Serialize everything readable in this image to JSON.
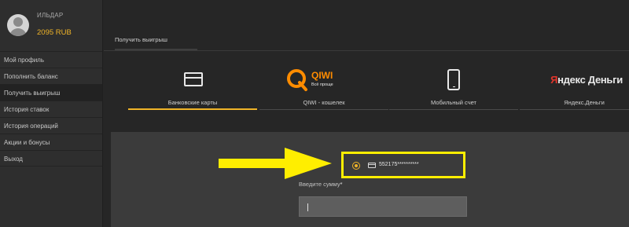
{
  "user": {
    "name": "ИЛЬДАР",
    "balance": "2095 RUB"
  },
  "sidebar": {
    "items": [
      {
        "label": "Мой профиль"
      },
      {
        "label": "Пополнить баланс"
      },
      {
        "label": "Получить выигрыш"
      },
      {
        "label": "История ставок"
      },
      {
        "label": "История операций"
      },
      {
        "label": "Акции и бонусы"
      },
      {
        "label": "Выход"
      }
    ],
    "active_index": 2
  },
  "header": {
    "tab_label": "Получить выигрыш"
  },
  "methods": [
    {
      "label": "Банковские карты",
      "icon": "bank-card-icon",
      "selected": true
    },
    {
      "label": "QIWI - кошелек",
      "icon": "qiwi-logo",
      "logo_text": "QIWI",
      "logo_subtext": "Всё проще",
      "selected": false
    },
    {
      "label": "Мобильный счет",
      "icon": "phone-icon",
      "selected": false
    },
    {
      "label": "Яндекс.Деньги",
      "icon": "yandex-money-logo",
      "logo_text_red": "Я",
      "logo_text": "ндекс Деньги",
      "selected": false
    }
  ],
  "form": {
    "card_number": "552175**********",
    "amount_label": "Введите сумму",
    "required_mark": "*",
    "amount_value": ""
  },
  "colors": {
    "accent": "#f0b428",
    "highlight": "#ffee00",
    "qiwi_orange": "#ff8c00",
    "yandex_red": "#e0352b"
  }
}
